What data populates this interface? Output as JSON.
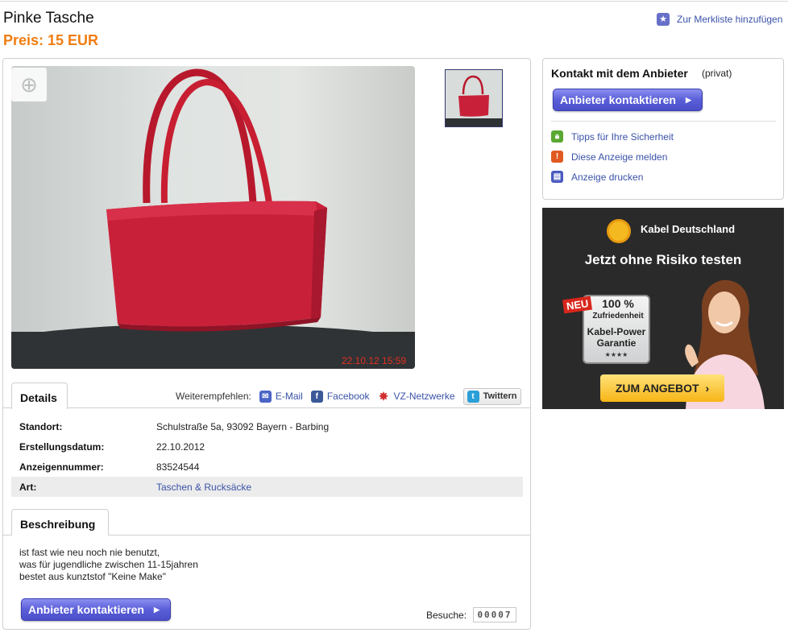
{
  "listing": {
    "title": "Pinke Tasche",
    "price": "Preis: 15 EUR",
    "favorite_link": "Zur Merkliste hinzufügen",
    "photo_timestamp": "22.10.12 15:59"
  },
  "tabs": {
    "details": "Details",
    "description": "Beschreibung"
  },
  "share": {
    "label": "Weiterempfehlen:",
    "email": "E-Mail",
    "facebook": "Facebook",
    "vz": "VZ-Netzwerke",
    "twitter": "Twittern"
  },
  "details": [
    {
      "label": "Standort:",
      "value": "Schulstraße 5a, 93092 Bayern - Barbing"
    },
    {
      "label": "Erstellungsdatum:",
      "value": "22.10.2012"
    },
    {
      "label": "Anzeigennummer:",
      "value": "83524544"
    },
    {
      "label": "Art:",
      "value": "Taschen & Rucksäcke"
    }
  ],
  "description": {
    "line1": "ist fast wie neu noch nie benutzt,",
    "line2": "was für jugendliche zwischen 11-15jahren",
    "line3": "bestet aus kunztstof \"Keine Make\""
  },
  "contact_button": "Anbieter kontaktieren",
  "visits": {
    "label": "Besuche:",
    "count": "00007"
  },
  "sidebar": {
    "title": "Kontakt mit dem Anbieter",
    "seller_type": "(privat)",
    "links": [
      {
        "label": "Tipps für Ihre Sicherheit",
        "icon": "lock-icon",
        "color": "#5aa832"
      },
      {
        "label": "Diese Anzeige melden",
        "icon": "warning-icon",
        "color": "#e05a20"
      },
      {
        "label": "Anzeige drucken",
        "icon": "printer-icon",
        "color": "#4a5ac0"
      }
    ]
  },
  "ad": {
    "brand": "Kabel Deutschland",
    "headline": "Jetzt ohne Risiko testen",
    "badge": "NEU",
    "percent": "100 %",
    "satisfaction": "Zufriedenheit",
    "guarantee_line1": "Kabel-Power",
    "guarantee_line2": "Garantie",
    "stars": "★★★★",
    "cta": "ZUM ANGEBOT"
  },
  "colors": {
    "price": "#f07d10",
    "link": "#3a52a8",
    "button": "#5a5ed8"
  }
}
